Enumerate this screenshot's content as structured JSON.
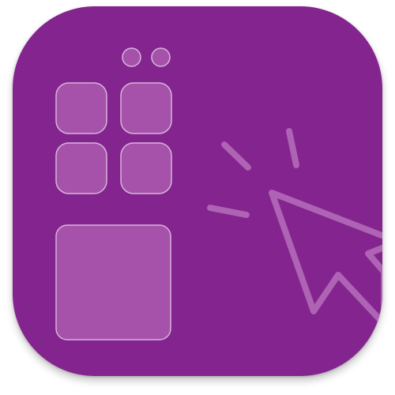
{
  "app_icon": {
    "icon_name": "control-center-grid-cursor-icon",
    "colors": {
      "background": "#84248e",
      "tile_fill": "#a652ab",
      "tile_stroke": "#d7b5db",
      "cursor_stroke": "#ae63b4"
    }
  }
}
